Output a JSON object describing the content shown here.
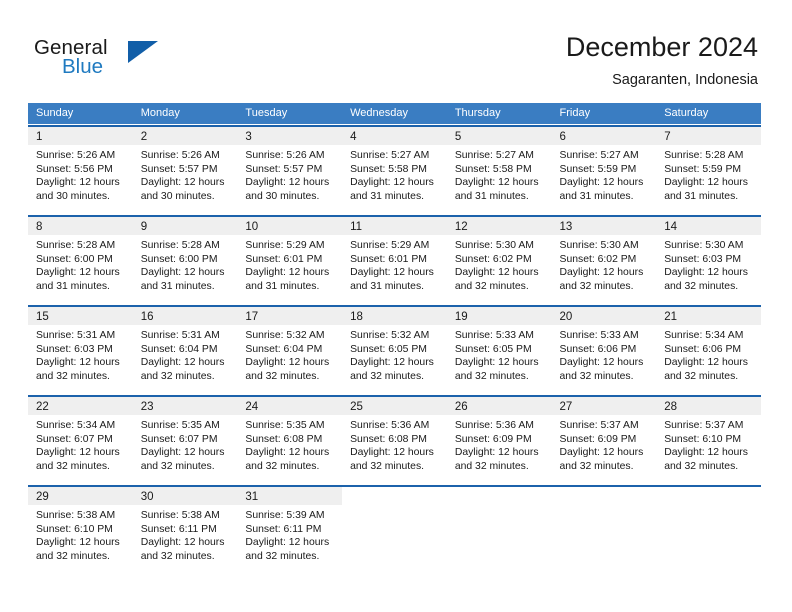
{
  "brand": {
    "word_one": "General",
    "word_two": "Blue",
    "logo_icon": "triangle-logo-icon",
    "accent_color": "#1f7ac0",
    "triangle_color": "#115ea8"
  },
  "header": {
    "title": "December 2024",
    "subtitle": "Sagaranten, Indonesia"
  },
  "theme": {
    "header_row_bg": "#3a7dc2",
    "week_separator": "#1c62ab",
    "daynum_band_bg": "#efefef",
    "text_color": "#1a1a1a"
  },
  "weekdays": [
    "Sunday",
    "Monday",
    "Tuesday",
    "Wednesday",
    "Thursday",
    "Friday",
    "Saturday"
  ],
  "weeks": [
    [
      {
        "day": "1",
        "sunrise": "Sunrise: 5:26 AM",
        "sunset": "Sunset: 5:56 PM",
        "daylight1": "Daylight: 12 hours",
        "daylight2": "and 30 minutes."
      },
      {
        "day": "2",
        "sunrise": "Sunrise: 5:26 AM",
        "sunset": "Sunset: 5:57 PM",
        "daylight1": "Daylight: 12 hours",
        "daylight2": "and 30 minutes."
      },
      {
        "day": "3",
        "sunrise": "Sunrise: 5:26 AM",
        "sunset": "Sunset: 5:57 PM",
        "daylight1": "Daylight: 12 hours",
        "daylight2": "and 30 minutes."
      },
      {
        "day": "4",
        "sunrise": "Sunrise: 5:27 AM",
        "sunset": "Sunset: 5:58 PM",
        "daylight1": "Daylight: 12 hours",
        "daylight2": "and 31 minutes."
      },
      {
        "day": "5",
        "sunrise": "Sunrise: 5:27 AM",
        "sunset": "Sunset: 5:58 PM",
        "daylight1": "Daylight: 12 hours",
        "daylight2": "and 31 minutes."
      },
      {
        "day": "6",
        "sunrise": "Sunrise: 5:27 AM",
        "sunset": "Sunset: 5:59 PM",
        "daylight1": "Daylight: 12 hours",
        "daylight2": "and 31 minutes."
      },
      {
        "day": "7",
        "sunrise": "Sunrise: 5:28 AM",
        "sunset": "Sunset: 5:59 PM",
        "daylight1": "Daylight: 12 hours",
        "daylight2": "and 31 minutes."
      }
    ],
    [
      {
        "day": "8",
        "sunrise": "Sunrise: 5:28 AM",
        "sunset": "Sunset: 6:00 PM",
        "daylight1": "Daylight: 12 hours",
        "daylight2": "and 31 minutes."
      },
      {
        "day": "9",
        "sunrise": "Sunrise: 5:28 AM",
        "sunset": "Sunset: 6:00 PM",
        "daylight1": "Daylight: 12 hours",
        "daylight2": "and 31 minutes."
      },
      {
        "day": "10",
        "sunrise": "Sunrise: 5:29 AM",
        "sunset": "Sunset: 6:01 PM",
        "daylight1": "Daylight: 12 hours",
        "daylight2": "and 31 minutes."
      },
      {
        "day": "11",
        "sunrise": "Sunrise: 5:29 AM",
        "sunset": "Sunset: 6:01 PM",
        "daylight1": "Daylight: 12 hours",
        "daylight2": "and 31 minutes."
      },
      {
        "day": "12",
        "sunrise": "Sunrise: 5:30 AM",
        "sunset": "Sunset: 6:02 PM",
        "daylight1": "Daylight: 12 hours",
        "daylight2": "and 32 minutes."
      },
      {
        "day": "13",
        "sunrise": "Sunrise: 5:30 AM",
        "sunset": "Sunset: 6:02 PM",
        "daylight1": "Daylight: 12 hours",
        "daylight2": "and 32 minutes."
      },
      {
        "day": "14",
        "sunrise": "Sunrise: 5:30 AM",
        "sunset": "Sunset: 6:03 PM",
        "daylight1": "Daylight: 12 hours",
        "daylight2": "and 32 minutes."
      }
    ],
    [
      {
        "day": "15",
        "sunrise": "Sunrise: 5:31 AM",
        "sunset": "Sunset: 6:03 PM",
        "daylight1": "Daylight: 12 hours",
        "daylight2": "and 32 minutes."
      },
      {
        "day": "16",
        "sunrise": "Sunrise: 5:31 AM",
        "sunset": "Sunset: 6:04 PM",
        "daylight1": "Daylight: 12 hours",
        "daylight2": "and 32 minutes."
      },
      {
        "day": "17",
        "sunrise": "Sunrise: 5:32 AM",
        "sunset": "Sunset: 6:04 PM",
        "daylight1": "Daylight: 12 hours",
        "daylight2": "and 32 minutes."
      },
      {
        "day": "18",
        "sunrise": "Sunrise: 5:32 AM",
        "sunset": "Sunset: 6:05 PM",
        "daylight1": "Daylight: 12 hours",
        "daylight2": "and 32 minutes."
      },
      {
        "day": "19",
        "sunrise": "Sunrise: 5:33 AM",
        "sunset": "Sunset: 6:05 PM",
        "daylight1": "Daylight: 12 hours",
        "daylight2": "and 32 minutes."
      },
      {
        "day": "20",
        "sunrise": "Sunrise: 5:33 AM",
        "sunset": "Sunset: 6:06 PM",
        "daylight1": "Daylight: 12 hours",
        "daylight2": "and 32 minutes."
      },
      {
        "day": "21",
        "sunrise": "Sunrise: 5:34 AM",
        "sunset": "Sunset: 6:06 PM",
        "daylight1": "Daylight: 12 hours",
        "daylight2": "and 32 minutes."
      }
    ],
    [
      {
        "day": "22",
        "sunrise": "Sunrise: 5:34 AM",
        "sunset": "Sunset: 6:07 PM",
        "daylight1": "Daylight: 12 hours",
        "daylight2": "and 32 minutes."
      },
      {
        "day": "23",
        "sunrise": "Sunrise: 5:35 AM",
        "sunset": "Sunset: 6:07 PM",
        "daylight1": "Daylight: 12 hours",
        "daylight2": "and 32 minutes."
      },
      {
        "day": "24",
        "sunrise": "Sunrise: 5:35 AM",
        "sunset": "Sunset: 6:08 PM",
        "daylight1": "Daylight: 12 hours",
        "daylight2": "and 32 minutes."
      },
      {
        "day": "25",
        "sunrise": "Sunrise: 5:36 AM",
        "sunset": "Sunset: 6:08 PM",
        "daylight1": "Daylight: 12 hours",
        "daylight2": "and 32 minutes."
      },
      {
        "day": "26",
        "sunrise": "Sunrise: 5:36 AM",
        "sunset": "Sunset: 6:09 PM",
        "daylight1": "Daylight: 12 hours",
        "daylight2": "and 32 minutes."
      },
      {
        "day": "27",
        "sunrise": "Sunrise: 5:37 AM",
        "sunset": "Sunset: 6:09 PM",
        "daylight1": "Daylight: 12 hours",
        "daylight2": "and 32 minutes."
      },
      {
        "day": "28",
        "sunrise": "Sunrise: 5:37 AM",
        "sunset": "Sunset: 6:10 PM",
        "daylight1": "Daylight: 12 hours",
        "daylight2": "and 32 minutes."
      }
    ],
    [
      {
        "day": "29",
        "sunrise": "Sunrise: 5:38 AM",
        "sunset": "Sunset: 6:10 PM",
        "daylight1": "Daylight: 12 hours",
        "daylight2": "and 32 minutes."
      },
      {
        "day": "30",
        "sunrise": "Sunrise: 5:38 AM",
        "sunset": "Sunset: 6:11 PM",
        "daylight1": "Daylight: 12 hours",
        "daylight2": "and 32 minutes."
      },
      {
        "day": "31",
        "sunrise": "Sunrise: 5:39 AM",
        "sunset": "Sunset: 6:11 PM",
        "daylight1": "Daylight: 12 hours",
        "daylight2": "and 32 minutes."
      },
      {
        "day": "",
        "sunrise": "",
        "sunset": "",
        "daylight1": "",
        "daylight2": ""
      },
      {
        "day": "",
        "sunrise": "",
        "sunset": "",
        "daylight1": "",
        "daylight2": ""
      },
      {
        "day": "",
        "sunrise": "",
        "sunset": "",
        "daylight1": "",
        "daylight2": ""
      },
      {
        "day": "",
        "sunrise": "",
        "sunset": "",
        "daylight1": "",
        "daylight2": ""
      }
    ]
  ]
}
